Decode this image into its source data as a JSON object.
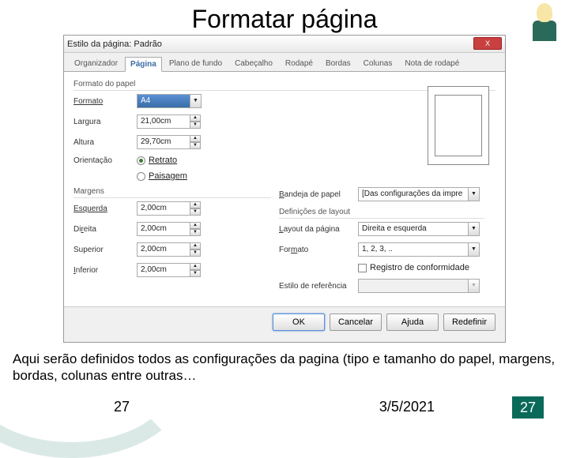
{
  "slide": {
    "title": "Formatar página",
    "caption": "Aqui serão definidos todos as configurações da pagina (tipo e tamanho do papel, margens, bordas, colunas entre outras…",
    "footer_num_left": "27",
    "footer_date": "3/5/2021",
    "footer_badge": "27"
  },
  "dialog": {
    "title": "Estilo da página: Padrão",
    "close": "X",
    "tabs": {
      "organizador": "Organizador",
      "pagina": "Página",
      "plano": "Plano de fundo",
      "cabecalho": "Cabeçalho",
      "rodape": "Rodapé",
      "bordas": "Bordas",
      "colunas": "Colunas",
      "nota": "Nota de rodapé"
    },
    "groups": {
      "papel": "Formato do papel",
      "margens": "Margens",
      "layout": "Definições de layout"
    },
    "labels": {
      "formato": "Formato",
      "largura": "Largura",
      "altura": "Altura",
      "orientacao": "Orientação",
      "retrato": "Retrato",
      "paisagem": "Paisagem",
      "bandeja": "Bandeja de papel",
      "esquerda": "Esquerda",
      "direita": "Direita",
      "superior": "Superior",
      "inferior": "Inferior",
      "layout_pag": "Layout da página",
      "formato_num": "Formato",
      "registro": "Registro de conformidade",
      "estilo_ref": "Estilo de referência"
    },
    "values": {
      "formato": "A4",
      "largura": "21,00cm",
      "altura": "29,70cm",
      "bandeja": "[Das configurações da impre",
      "esquerda": "2,00cm",
      "direita": "2,00cm",
      "superior": "2,00cm",
      "inferior": "2,00cm",
      "layout_pag": "Direita e esquerda",
      "formato_num": "1, 2, 3, ..",
      "estilo_ref": ""
    },
    "buttons": {
      "ok": "OK",
      "cancelar": "Cancelar",
      "ajuda": "Ajuda",
      "redefinir": "Redefinir"
    }
  }
}
